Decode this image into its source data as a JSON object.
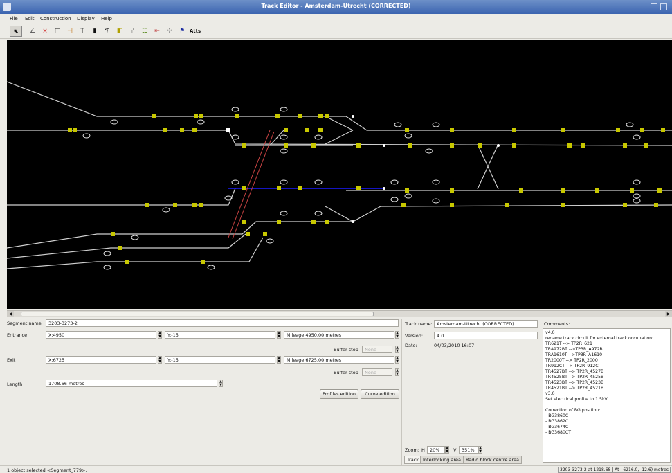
{
  "window": {
    "title": "Track Editor - Amsterdam-Utrecht (CORRECTED)"
  },
  "menu": [
    "File",
    "Edit",
    "Construction",
    "Display",
    "Help"
  ],
  "toolbar": {
    "tools": [
      "select-icon",
      "segment-icon",
      "delete-icon",
      "node-icon",
      "buffer-icon",
      "text-icon",
      "signal-icon",
      "signal-post-icon",
      "balise-icon",
      "switch-icon",
      "level-crossing-icon",
      "marker-icon",
      "flag-icon"
    ],
    "atts_label": "Atts"
  },
  "segment": {
    "name_label": "Segment name",
    "name_value": "3203-3273-2",
    "entrance_label": "Entrance",
    "entrance_x": "X:4950",
    "entrance_y": "Y:-15",
    "entrance_mileage": "Mileage 4950.00 metres",
    "buffer_stop_label": "Buffer stop",
    "buffer_stop_value": "None",
    "exit_label": "Exit",
    "exit_x": "X:6725",
    "exit_y": "Y:-15",
    "exit_mileage": "Mileage 6725.00 metres",
    "length_label": "Length",
    "length_value": "1708.66 metres",
    "profiles_btn": "Profiles edition",
    "curve_btn": "Curve edition"
  },
  "track": {
    "name_label": "Track name:",
    "name_value": "Amsterdam-Utrecht (CORRECTED)",
    "version_label": "Version:",
    "version_value": "4.0",
    "date_label": "Date:",
    "date_value": "04/03/2010 16:07",
    "zoom_label": "Zoom:",
    "zoom_h_label": "H",
    "zoom_h_value": "20%",
    "zoom_v_label": "V",
    "zoom_v_value": "351%",
    "tabs": [
      "Track",
      "Interlocking area",
      "Radio block centre area"
    ]
  },
  "comments": {
    "label": "Comments:",
    "text": "v4.0\nrename track circuit for external track occupation:\nTR621T --> TP2R_621\nTRA972BT -->TP3R_A972B\nTRA1610T -->TP3R_A1610\nTR2000T --> TP2R_2000\nTR912CT --> TP2R_912C\nTR4527BT --> TP2R_4527B\nTR4525BT --> TP2R_4525B\nTR4523BT --> TP2R_4523B\nTR4521BT --> TP2R_4521B\nv3.0\nSet electrical profile to 1.5kV\n\nCorrection of BG position:\n- BG3860C\n- BG3862C\n- BG3674C\n- BG3680CT"
  },
  "status": {
    "left": "1 object selected <Segment_779>.",
    "right": "3203-3273-2 at 1218.68 | At | 6216.0, -12.6) metres"
  },
  "colors": {
    "canvas": "#000000",
    "track": "#d0d0d0",
    "selected": "#1a1aff",
    "balise": "#c8c800",
    "route": "#cc4444"
  }
}
